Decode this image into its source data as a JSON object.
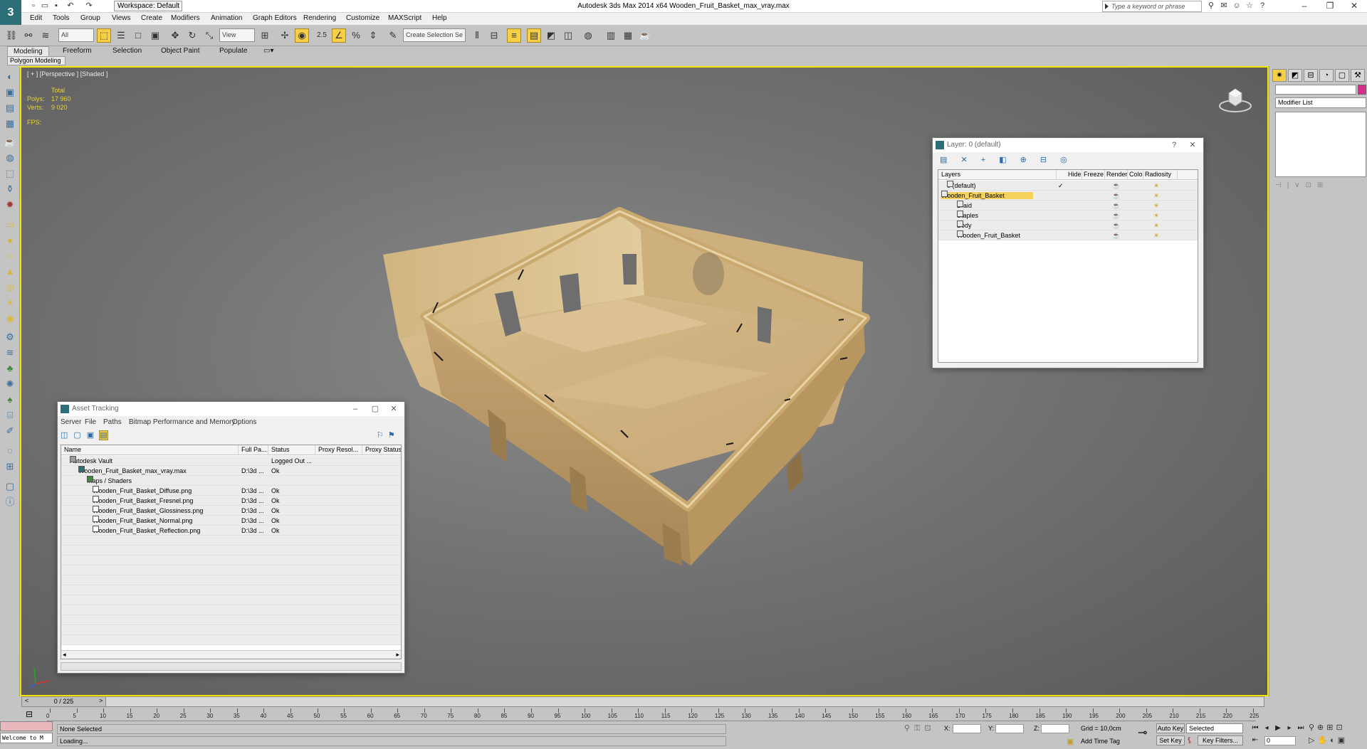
{
  "window": {
    "title": "Autodesk 3ds Max  2014 x64     Wooden_Fruit_Basket_max_vray.max",
    "workspace": "Workspace: Default",
    "search_placeholder": "Type a keyword or phrase"
  },
  "menu": [
    "Edit",
    "Tools",
    "Group",
    "Views",
    "Create",
    "Modifiers",
    "Animation",
    "Graph Editors",
    "Rendering",
    "Customize",
    "MAXScript",
    "Help"
  ],
  "toolbar": {
    "filter": "All",
    "ref_coord": "View",
    "snap_label": "2.5",
    "selection_set": "Create Selection Se"
  },
  "ribbon": {
    "tabs": [
      "Modeling",
      "Freeform",
      "Selection",
      "Object Paint",
      "Populate"
    ],
    "sub": "Polygon Modeling"
  },
  "viewport": {
    "label": "[ + ] [Perspective ] [Shaded ]",
    "total": "Total",
    "polys_label": "Polys:",
    "polys": "17 960",
    "verts_label": "Verts:",
    "verts": "9 020",
    "fps": "FPS:"
  },
  "command_panel": {
    "modifier_list": "Modifier List",
    "accent": "#d62f8b"
  },
  "layer_dialog": {
    "title": "Layer: 0 (default)",
    "columns": [
      "Layers",
      "Hide",
      "Freeze",
      "Render",
      "Color",
      "Radiosity"
    ],
    "rows": [
      {
        "name": "0 (default)",
        "color": "#4d7fd1",
        "current": true
      },
      {
        "name": "Wooden_Fruit_Basket",
        "color": "#d9d9d9",
        "selected": true
      },
      {
        "name": "Braid",
        "color": "#111111"
      },
      {
        "name": "Staples",
        "color": "#111111"
      },
      {
        "name": "Body",
        "color": "#111111"
      },
      {
        "name": "Wooden_Fruit_Basket",
        "color": "#111111"
      }
    ]
  },
  "asset_dialog": {
    "title": "Asset Tracking",
    "menu": [
      "Server",
      "File",
      "Paths",
      "Bitmap Performance and Memory",
      "Options"
    ],
    "columns": [
      "Name",
      "Full Pa...",
      "Status",
      "Proxy Resol...",
      "Proxy Status"
    ],
    "rows": [
      {
        "name": "Autodesk Vault",
        "path": "",
        "status": "Logged Out ..."
      },
      {
        "name": "Wooden_Fruit_Basket_max_vray.max",
        "path": "D:\\3d ...",
        "status": "Ok"
      },
      {
        "name": "Maps / Shaders",
        "path": "",
        "status": ""
      },
      {
        "name": "Wooden_Fruit_Basket_Diffuse.png",
        "path": "D:\\3d ...",
        "status": "Ok"
      },
      {
        "name": "Wooden_Fruit_Basket_Fresnel.png",
        "path": "D:\\3d ...",
        "status": "Ok"
      },
      {
        "name": "Wooden_Fruit_Basket_Glossiness.png",
        "path": "D:\\3d ...",
        "status": "Ok"
      },
      {
        "name": "Wooden_Fruit_Basket_Normal.png",
        "path": "D:\\3d ...",
        "status": "Ok"
      },
      {
        "name": "Wooden_Fruit_Basket_Reflection.png",
        "path": "D:\\3d ...",
        "status": "Ok"
      }
    ]
  },
  "timeline": {
    "frame": "0 / 225",
    "ticks": [
      "0",
      "5",
      "10",
      "15",
      "20",
      "25",
      "30",
      "35",
      "40",
      "45",
      "50",
      "55",
      "60",
      "65",
      "70",
      "75",
      "80",
      "85",
      "90",
      "95",
      "100",
      "105",
      "110",
      "115",
      "120",
      "125",
      "130",
      "135",
      "140",
      "145",
      "150",
      "155",
      "160",
      "165",
      "170",
      "175",
      "180",
      "185",
      "190",
      "195",
      "200",
      "205",
      "210",
      "215",
      "220",
      "225"
    ]
  },
  "status": {
    "selection": "None Selected",
    "prompt": "Loading...",
    "maxscript": "Welcome to M",
    "x": "X:",
    "y": "Y:",
    "z": "Z:",
    "grid": "Grid = 10,0cm",
    "auto_key": "Auto Key",
    "set_key": "Set Key",
    "key_mode": "Selected",
    "key_filters": "Key Filters...",
    "add_time_tag": "Add Time Tag",
    "current_frame": "0"
  }
}
